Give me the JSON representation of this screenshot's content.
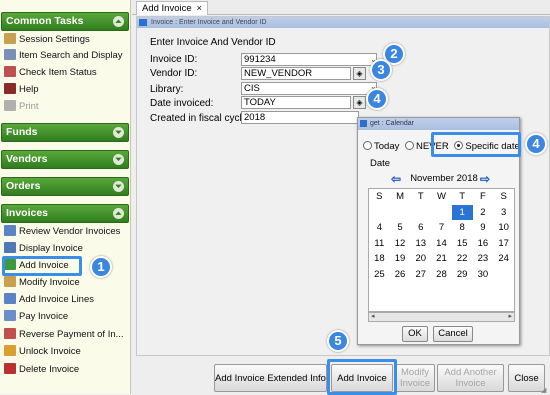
{
  "sidebar": {
    "common_tasks": "Common Tasks",
    "common_items": [
      "Session Settings",
      "Item Search and Display",
      "Check Item Status",
      "Help",
      "Print"
    ],
    "funds": "Funds",
    "vendors": "Vendors",
    "orders": "Orders",
    "invoices": "Invoices",
    "invoice_items": [
      "Review Vendor Invoices",
      "Display Invoice",
      "Add Invoice",
      "Modify Invoice",
      "Add Invoice Lines",
      "Pay Invoice",
      "Reverse Payment of In...",
      "Unlock Invoice",
      "Delete Invoice"
    ]
  },
  "tab": {
    "label": "Add Invoice",
    "close": "×"
  },
  "window_title": "Invoice : Enter Invoice and Vendor ID",
  "form": {
    "heading": "Enter Invoice And Vendor ID",
    "invoice_id_label": "Invoice ID:",
    "invoice_id_value": "991234",
    "vendor_id_label": "Vendor ID:",
    "vendor_id_value": "NEW_VENDOR",
    "library_label": "Library:",
    "library_value": "CIS",
    "date_label": "Date invoiced:",
    "date_value": "TODAY",
    "fiscal_label": "Created in fiscal cycle:",
    "fiscal_value": "2018"
  },
  "calendar": {
    "title": "get : Calendar",
    "radio_today": "Today",
    "radio_never": "NEVER",
    "radio_specific": "Specific date",
    "date_label": "Date",
    "month": "November 2018",
    "days": [
      "S",
      "M",
      "T",
      "W",
      "T",
      "F",
      "S"
    ],
    "weeks": [
      [
        "",
        "",
        "",
        "",
        "1",
        "2",
        "3"
      ],
      [
        "4",
        "5",
        "6",
        "7",
        "8",
        "9",
        "10"
      ],
      [
        "11",
        "12",
        "13",
        "14",
        "15",
        "16",
        "17"
      ],
      [
        "18",
        "19",
        "20",
        "21",
        "22",
        "23",
        "24"
      ],
      [
        "25",
        "26",
        "27",
        "28",
        "29",
        "30",
        ""
      ]
    ],
    "selected_day": "1",
    "ok": "OK",
    "cancel": "Cancel"
  },
  "buttons": {
    "extended": "Add Invoice Extended Info",
    "add": "Add Invoice",
    "modify": "Modify Invoice",
    "add_another": "Add Another Invoice",
    "close": "Close"
  },
  "callouts": [
    "1",
    "2",
    "3",
    "4",
    "4",
    "5"
  ],
  "colors": {
    "panel_green": "#2f7d1e",
    "highlight_blue": "#3b8ee8",
    "callout_blue": "#3a86e0",
    "selected_day": "#2a74d4"
  },
  "icons": {
    "common": [
      "settings-icon",
      "search-icon",
      "status-icon",
      "help-icon",
      "print-icon"
    ],
    "invoices": [
      "review-icon",
      "display-icon",
      "add-icon",
      "modify-icon",
      "lines-icon",
      "pay-icon",
      "reverse-icon",
      "unlock-icon",
      "delete-icon"
    ]
  }
}
